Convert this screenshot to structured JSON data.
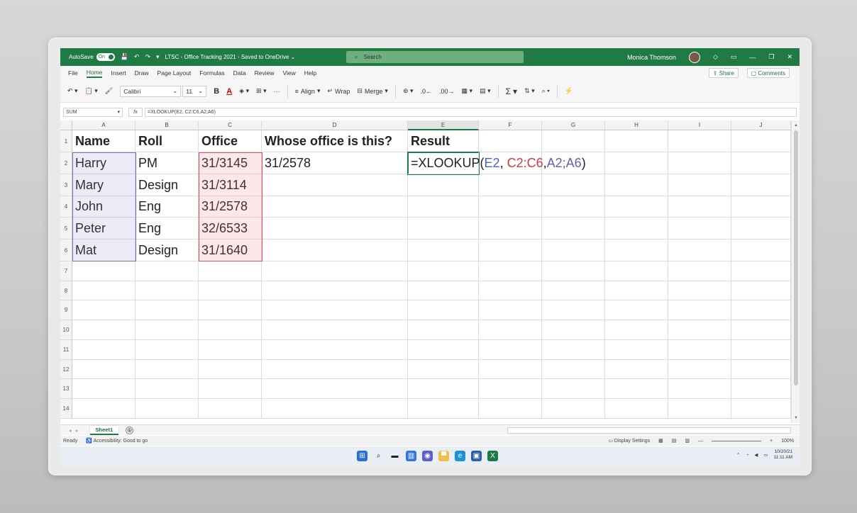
{
  "titlebar": {
    "autosave_label": "AutoSave",
    "autosave_state": "On",
    "doc_title": "LTSC - Office Tracking 2021 - Saved to OneDrive ⌄",
    "search_placeholder": "Search",
    "user_name": "Monica Thomson",
    "accent_color": "#1f7a44"
  },
  "menu": {
    "items": [
      "File",
      "Home",
      "Insert",
      "Draw",
      "Page Layout",
      "Formulas",
      "Data",
      "Review",
      "View",
      "Help"
    ],
    "active": "Home",
    "share_label": "Share",
    "comments_label": "Comments"
  },
  "ribbon": {
    "font_name": "Calibri",
    "font_size": "11",
    "bold_label": "B",
    "font_color_label": "A",
    "align_label": "Align",
    "wrap_label": "Wrap",
    "merge_label": "Merge",
    "sum_label": "Σ"
  },
  "formula_bar": {
    "name_box": "SUM",
    "fx_label": "fx",
    "formula": "=XLOOKUP(E2, C2:C6,A2;A6)"
  },
  "columns": [
    "A",
    "B",
    "C",
    "D",
    "E",
    "F",
    "G",
    "H",
    "I",
    "J"
  ],
  "rows": [
    "1",
    "2",
    "3",
    "4",
    "5",
    "6",
    "7",
    "8",
    "9",
    "10",
    "11",
    "12",
    "13",
    "14"
  ],
  "cells": {
    "header": [
      "Name",
      "Roll",
      "Office",
      "Whose office is this?",
      "Result"
    ],
    "data": [
      [
        "Harry",
        "PM",
        "31/3145",
        "31/2578"
      ],
      [
        "Mary",
        "Design",
        "31/3114",
        ""
      ],
      [
        "John",
        "Eng",
        "31/2578",
        ""
      ],
      [
        "Peter",
        "Eng",
        "32/6533",
        ""
      ],
      [
        "Mat",
        "Design",
        "31/1640",
        ""
      ]
    ],
    "e2_formula": {
      "prefix": "=XLOOKUP(",
      "arg1": "E2",
      "comma1": ", ",
      "arg2": "C2:C6",
      "comma2": ",",
      "arg3": "A2;A6",
      "suffix": ")"
    }
  },
  "sheet": {
    "tab_name": "Sheet1",
    "add_label": "⊕"
  },
  "status": {
    "ready": "Ready",
    "accessibility": "Accessibility: Good to go",
    "display_settings": "Display Settings",
    "zoom": "100%"
  },
  "taskbar": {
    "date": "10/20/21",
    "time": "11:11 AM"
  }
}
